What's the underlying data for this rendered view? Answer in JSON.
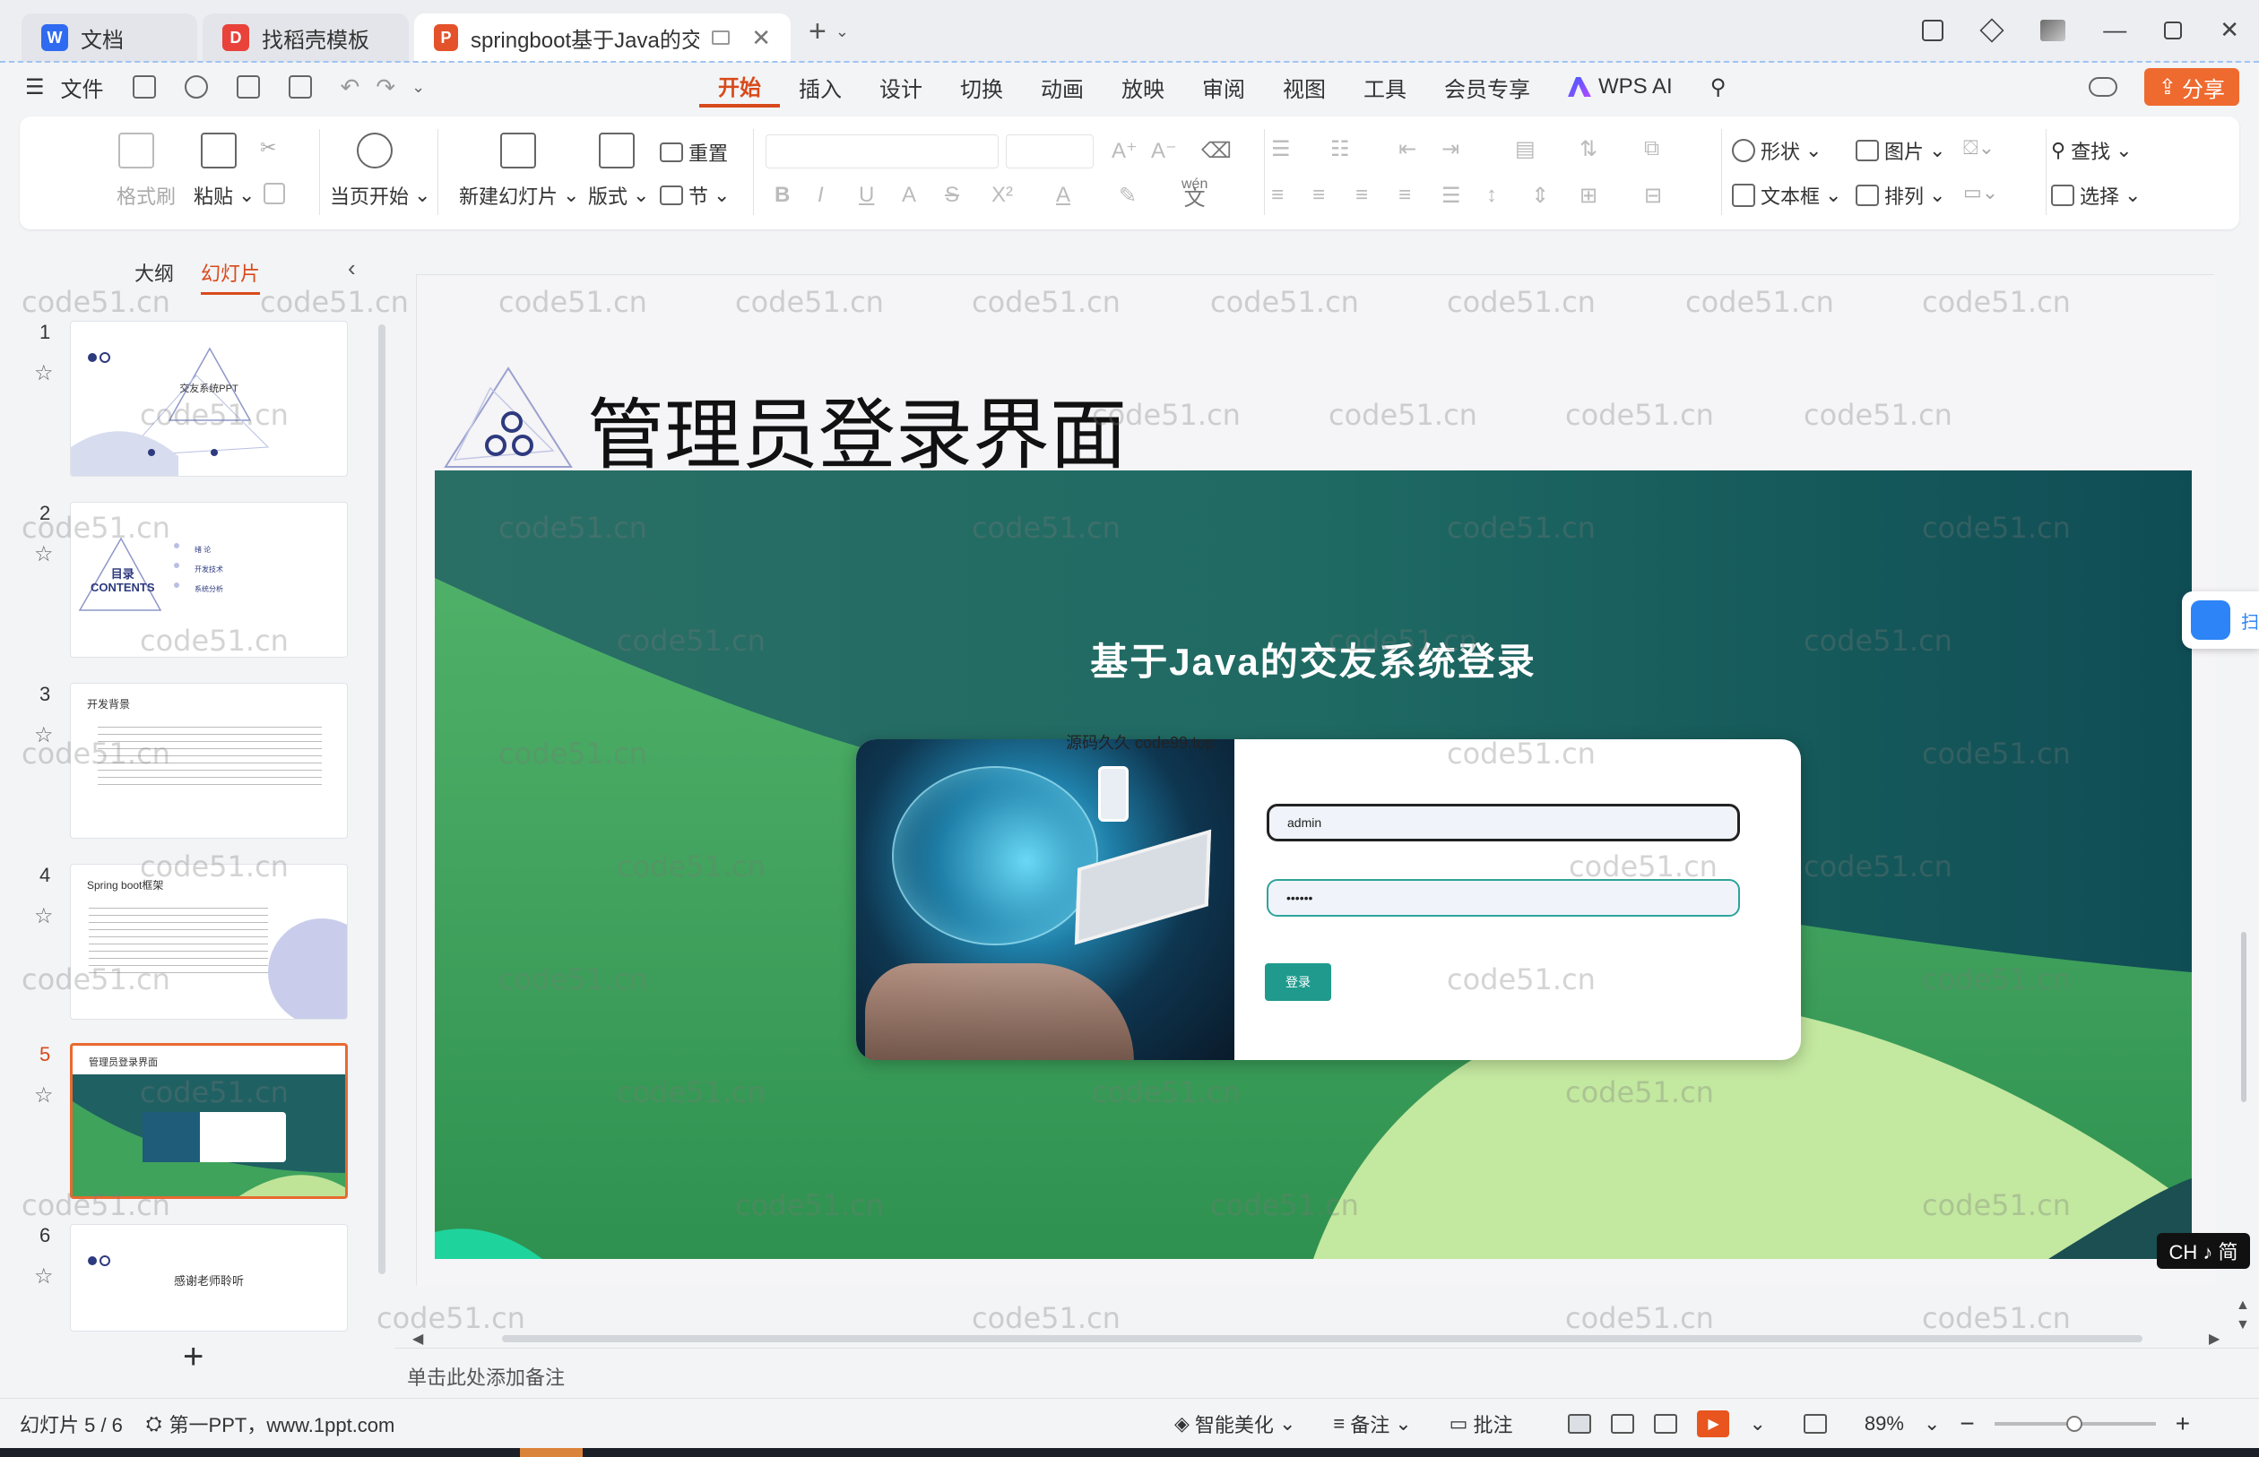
{
  "tabs": [
    {
      "label": "文档",
      "icon": "doc-icon"
    },
    {
      "label": "找稻壳模板",
      "icon": "template-icon"
    },
    {
      "label": "springboot基于Java的交友",
      "icon": "ppt-icon"
    }
  ],
  "menu": {
    "file": "文件",
    "tabs": [
      "开始",
      "插入",
      "设计",
      "切换",
      "动画",
      "放映",
      "审阅",
      "视图",
      "工具",
      "会员专享"
    ],
    "wps_ai": "WPS AI",
    "share": "分享"
  },
  "ribbon": {
    "format_painter": "格式刷",
    "paste": "粘贴",
    "from_current": "当页开始",
    "new_slide": "新建幻灯片",
    "layout": "版式",
    "reset": "重置",
    "section": "节",
    "shape": "形状",
    "picture": "图片",
    "find": "查找",
    "textbox": "文本框",
    "arrange": "排列",
    "select": "选择",
    "wen": "wén",
    "wen_char": "文"
  },
  "panel": {
    "outline_tab": "大纲",
    "slides_tab": "幻灯片",
    "thumbs": [
      {
        "num": "1",
        "title": "交友系统PPT"
      },
      {
        "num": "2",
        "title": "目录",
        "subtitle": "CONTENTS",
        "items": [
          "绪 论",
          "开发技术",
          "系统分析"
        ]
      },
      {
        "num": "3",
        "title": "开发背景"
      },
      {
        "num": "4",
        "title": "Spring boot框架"
      },
      {
        "num": "5",
        "title": "管理员登录界面"
      },
      {
        "num": "6",
        "title": "感谢老师聆听"
      }
    ]
  },
  "slide": {
    "title": "管理员登录界面",
    "login_title": "基于Java的交友系统登录",
    "username": "admin",
    "password": "••••••",
    "button": "登录",
    "source_watermark": "源码久久 code99.top"
  },
  "watermark": "code51.cn",
  "float_widget": "扫",
  "ime": "CH ♪ 简",
  "notes_placeholder": "单击此处添加备注",
  "status": {
    "slide_counter": "幻灯片 5 / 6",
    "theme": "第一PPT，www.1ppt.com",
    "beautify": "智能美化",
    "notes": "备注",
    "comments": "批注",
    "zoom": "89%"
  },
  "colors": {
    "accent": "#d84a1b",
    "share": "#ee6a2f",
    "teal_dark": "#1d5e63",
    "green_mid": "#3fa35c",
    "green_light": "#bfe497"
  }
}
